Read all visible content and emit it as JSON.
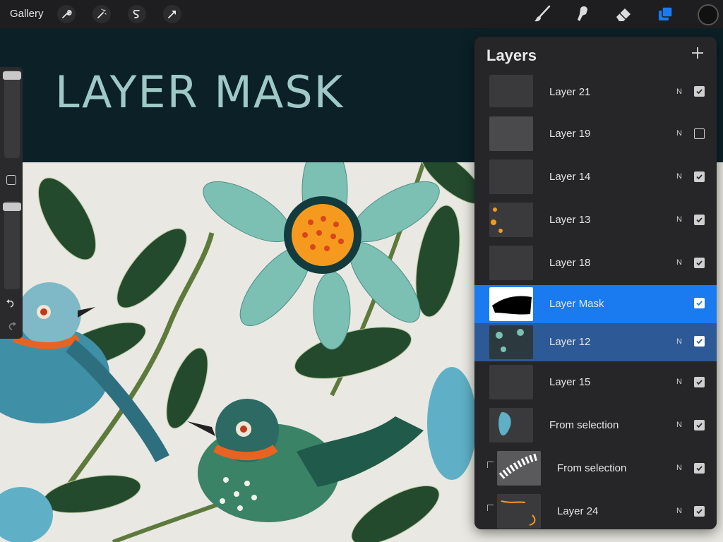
{
  "toolbar": {
    "gallery_label": "Gallery",
    "left_icons": [
      "wrench-icon",
      "magic-wand-icon",
      "selection-icon",
      "transform-arrow-icon"
    ],
    "right_icons": [
      "brush-icon",
      "smudge-icon",
      "eraser-icon",
      "layers-icon"
    ],
    "active_color": "#111111",
    "layers_icon_color": "#1a7bf0"
  },
  "canvas": {
    "title": "LAYER MASK",
    "banner_color": "#0b2127",
    "title_color": "#9fc9c6",
    "paper_color": "#e9e8e2"
  },
  "sidebar": {
    "brush_size_level": 0.95,
    "opacity_level": 0.95,
    "icons": [
      "modify-square-icon",
      "undo-icon",
      "redo-icon"
    ]
  },
  "layers_panel": {
    "title": "Layers",
    "add_icon": "plus-icon",
    "layers": [
      {
        "name": "Layer 21",
        "blend": "N",
        "visible": true,
        "state": "normal",
        "clipped": false
      },
      {
        "name": "Layer 19",
        "blend": "N",
        "visible": false,
        "state": "normal",
        "clipped": false
      },
      {
        "name": "Layer 14",
        "blend": "N",
        "visible": true,
        "state": "normal",
        "clipped": false
      },
      {
        "name": "Layer 13",
        "blend": "N",
        "visible": true,
        "state": "normal",
        "clipped": false
      },
      {
        "name": "Layer 18",
        "blend": "N",
        "visible": true,
        "state": "normal",
        "clipped": false
      },
      {
        "name": "Layer Mask",
        "blend": "",
        "visible": true,
        "state": "active",
        "clipped": false
      },
      {
        "name": "Layer 12",
        "blend": "N",
        "visible": true,
        "state": "selected",
        "clipped": false
      },
      {
        "name": "Layer 15",
        "blend": "N",
        "visible": true,
        "state": "normal",
        "clipped": false
      },
      {
        "name": "From selection",
        "blend": "N",
        "visible": true,
        "state": "normal",
        "clipped": false
      },
      {
        "name": "From selection",
        "blend": "N",
        "visible": true,
        "state": "normal",
        "clipped": true
      },
      {
        "name": "Layer 24",
        "blend": "N",
        "visible": true,
        "state": "normal",
        "clipped": true
      }
    ]
  }
}
